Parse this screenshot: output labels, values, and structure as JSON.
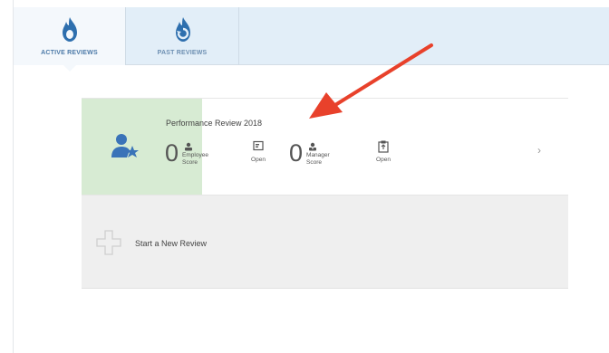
{
  "tabs": [
    {
      "label": "ACTIVE REVIEWS",
      "icon": "flame-icon",
      "active": true
    },
    {
      "label": "PAST REVIEWS",
      "icon": "flame-history-icon",
      "active": false
    }
  ],
  "review": {
    "title": "Performance Review 2018",
    "employee_score": "0",
    "employee_score_label": "Employee Score",
    "employee_status": "Open",
    "manager_score": "0",
    "manager_score_label": "Manager Score",
    "manager_status": "Open",
    "chevron": "›"
  },
  "new_review": {
    "label": "Start a New Review"
  },
  "colors": {
    "topbar": "#e2eef8",
    "tab_icon": "#2e6fae",
    "card_accent": "#d7ebd3",
    "user_icon": "#3a73b8",
    "arrow": "#e8412b",
    "new_review_bg": "#efefef"
  }
}
